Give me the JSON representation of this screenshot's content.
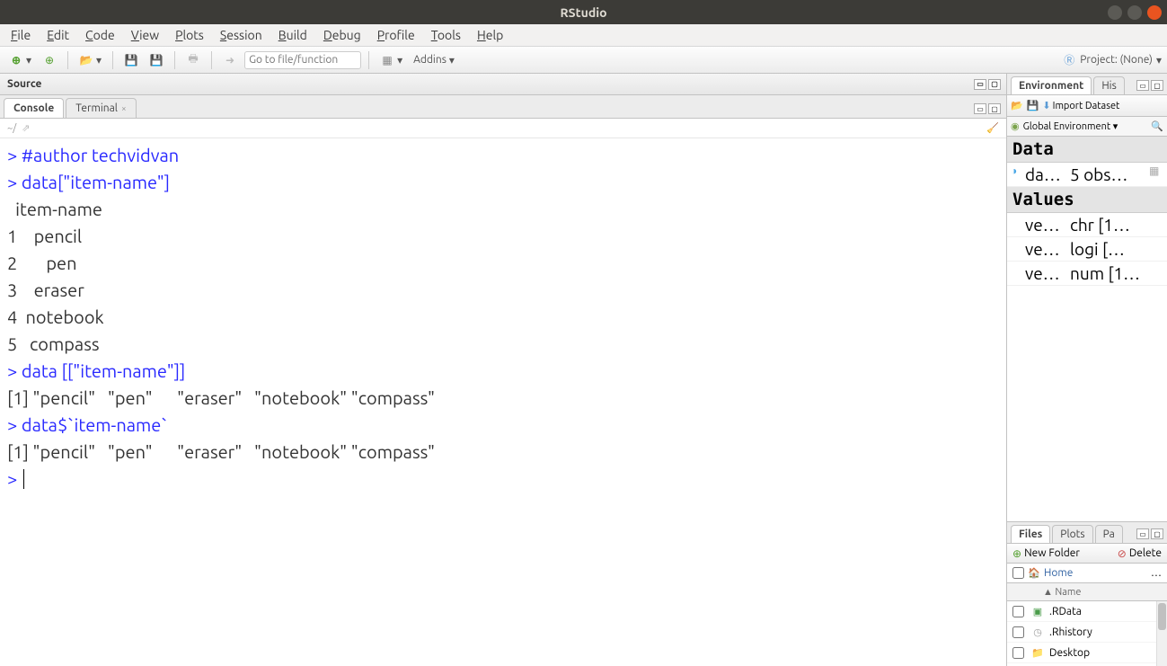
{
  "window": {
    "title": "RStudio"
  },
  "menu": {
    "items": [
      "File",
      "Edit",
      "Code",
      "View",
      "Plots",
      "Session",
      "Build",
      "Debug",
      "Profile",
      "Tools",
      "Help"
    ]
  },
  "toolbar": {
    "goto_placeholder": "Go to file/function",
    "addins_label": "Addins",
    "project_label": "Project: (None)"
  },
  "source_pane": {
    "title": "Source"
  },
  "console_tabs": {
    "console": "Console",
    "terminal": "Terminal"
  },
  "console_path": "~/",
  "console": {
    "l1_prompt": "> ",
    "l1_cmd": "#author techvidvan",
    "l2_prompt": "> ",
    "l2_cmd": "data[\"item-name\"]",
    "l3": "  item-name",
    "l4": "1    pencil",
    "l5": "2       pen",
    "l6": "3    eraser",
    "l7": "4  notebook",
    "l8": "5   compass",
    "l9_prompt": "> ",
    "l9_cmd": "data [[\"item-name\"]]",
    "l10": "[1] \"pencil\"   \"pen\"      \"eraser\"   \"notebook\" \"compass\" ",
    "l11_prompt": "> ",
    "l11_cmd": "data$`item-name`",
    "l12": "[1] \"pencil\"   \"pen\"      \"eraser\"   \"notebook\" \"compass\" ",
    "l13_prompt": "> "
  },
  "env_tabs": {
    "env": "Environment",
    "hist": "His"
  },
  "env_toolbar": {
    "import": "Import Dataset",
    "scope": "Global Environment"
  },
  "env": {
    "data_header": "Data",
    "values_header": "Values",
    "data_row": {
      "name": "da…",
      "val": "5 obs…"
    },
    "v1": {
      "name": "ve…",
      "val": "chr [1…"
    },
    "v2": {
      "name": "ve…",
      "val": "logi […"
    },
    "v3": {
      "name": "ve…",
      "val": "num [1…"
    }
  },
  "files_tabs": {
    "files": "Files",
    "plots": "Plots",
    "packages": "Pa"
  },
  "files_toolbar": {
    "new_folder": "New Folder",
    "delete": "Delete"
  },
  "files_path": {
    "home": "Home",
    "more": "…"
  },
  "files_header": {
    "name": "▲ Name"
  },
  "files": {
    "r1": ".RData",
    "r2": ".Rhistory",
    "r3": "Desktop"
  }
}
